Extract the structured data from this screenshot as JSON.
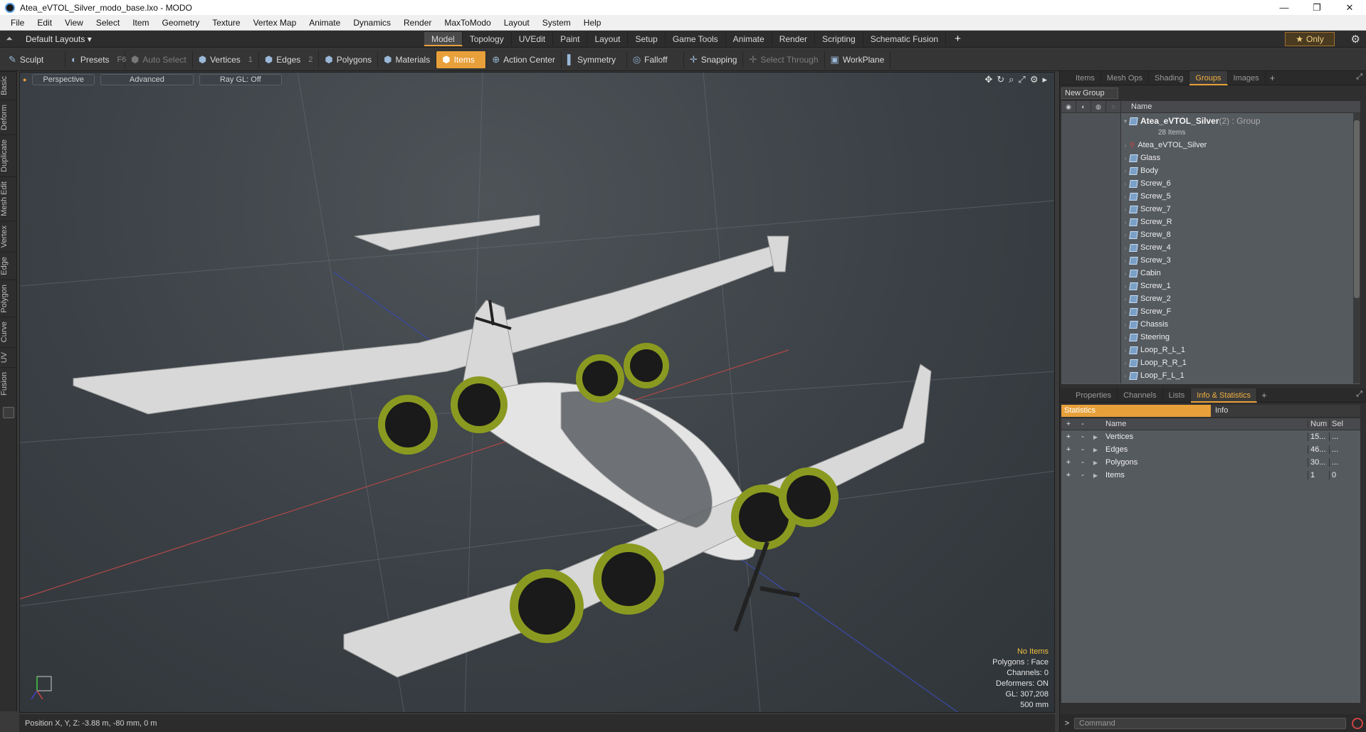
{
  "window": {
    "title": "Atea_eVTOL_Silver_modo_base.lxo - MODO",
    "controls": [
      "—",
      "❐",
      "✕"
    ]
  },
  "menu": [
    "File",
    "Edit",
    "View",
    "Select",
    "Item",
    "Geometry",
    "Texture",
    "Vertex Map",
    "Animate",
    "Dynamics",
    "Render",
    "MaxToModo",
    "Layout",
    "System",
    "Help"
  ],
  "modebar": {
    "layout": "Default Layouts ▾",
    "tabs": [
      "Model",
      "Topology",
      "UVEdit",
      "Paint",
      "Layout",
      "Setup",
      "Game Tools",
      "Animate",
      "Render",
      "Scripting",
      "Schematic Fusion"
    ],
    "active_tab": "Model",
    "only_label": "Only"
  },
  "toolbar": {
    "sculpt": "Sculpt",
    "presets": "Presets",
    "presets_key": "F6",
    "auto_select": "Auto Select",
    "vertices": "Vertices",
    "vertices_count": "1",
    "edges": "Edges",
    "edges_count": "2",
    "polygons": "Polygons",
    "materials": "Materials",
    "items": "Items",
    "action_center": "Action Center",
    "symmetry": "Symmetry",
    "falloff": "Falloff",
    "snapping": "Snapping",
    "select_through": "Select Through",
    "workplane": "WorkPlane"
  },
  "left_tabs": [
    "Basic",
    "Deform",
    "Duplicate",
    "Mesh Edit",
    "Vertex",
    "Edge",
    "Polygon",
    "Curve",
    "UV",
    "Fusion"
  ],
  "viewport": {
    "view": "Perspective",
    "shading": "Advanced",
    "raygl": "Ray GL: Off",
    "info": {
      "no_items": "No Items",
      "polygons": "Polygons : Face",
      "channels": "Channels: 0",
      "deformers": "Deformers: ON",
      "gl": "GL: 307,208",
      "scale": "500 mm"
    }
  },
  "status": {
    "position": "Position X, Y, Z:   -3.88 m, -80 mm, 0 m"
  },
  "groups_panel": {
    "tabs": [
      "Items",
      "Mesh Ops",
      "Shading",
      "Groups",
      "Images"
    ],
    "active_tab": "Groups",
    "new_group": "New Group",
    "column_name": "Name",
    "group_name": "Atea_eVTOL_Silver",
    "group_suffix": " (2) : Group",
    "group_count": "28 Items",
    "items": [
      "Atea_eVTOL_Silver",
      "Glass",
      "Body",
      "Screw_6",
      "Screw_5",
      "Screw_7",
      "Screw_R",
      "Screw_8",
      "Screw_4",
      "Screw_3",
      "Cabin",
      "Screw_1",
      "Screw_2",
      "Screw_F",
      "Chassis",
      "Steering",
      "Loop_R_L_1",
      "Loop_R_R_1",
      "Loop_F_L_1"
    ]
  },
  "props_panel": {
    "tabs": [
      "Properties",
      "Channels",
      "Lists",
      "Info & Statistics"
    ],
    "active_tab": "Info & Statistics",
    "statistics_label": "Statistics",
    "info_label": "Info",
    "columns": {
      "name": "Name",
      "num": "Num",
      "sel": "Sel"
    },
    "rows": [
      {
        "name": "Vertices",
        "num": "15...",
        "sel": "..."
      },
      {
        "name": "Edges",
        "num": "46...",
        "sel": "..."
      },
      {
        "name": "Polygons",
        "num": "30...",
        "sel": "..."
      },
      {
        "name": "Items",
        "num": "1",
        "sel": "0"
      }
    ]
  },
  "command": {
    "prompt": ">",
    "placeholder": "Command"
  },
  "colors": {
    "accent": "#e8a03a",
    "viewport": "#3a4045",
    "panel": "#555a5f"
  }
}
